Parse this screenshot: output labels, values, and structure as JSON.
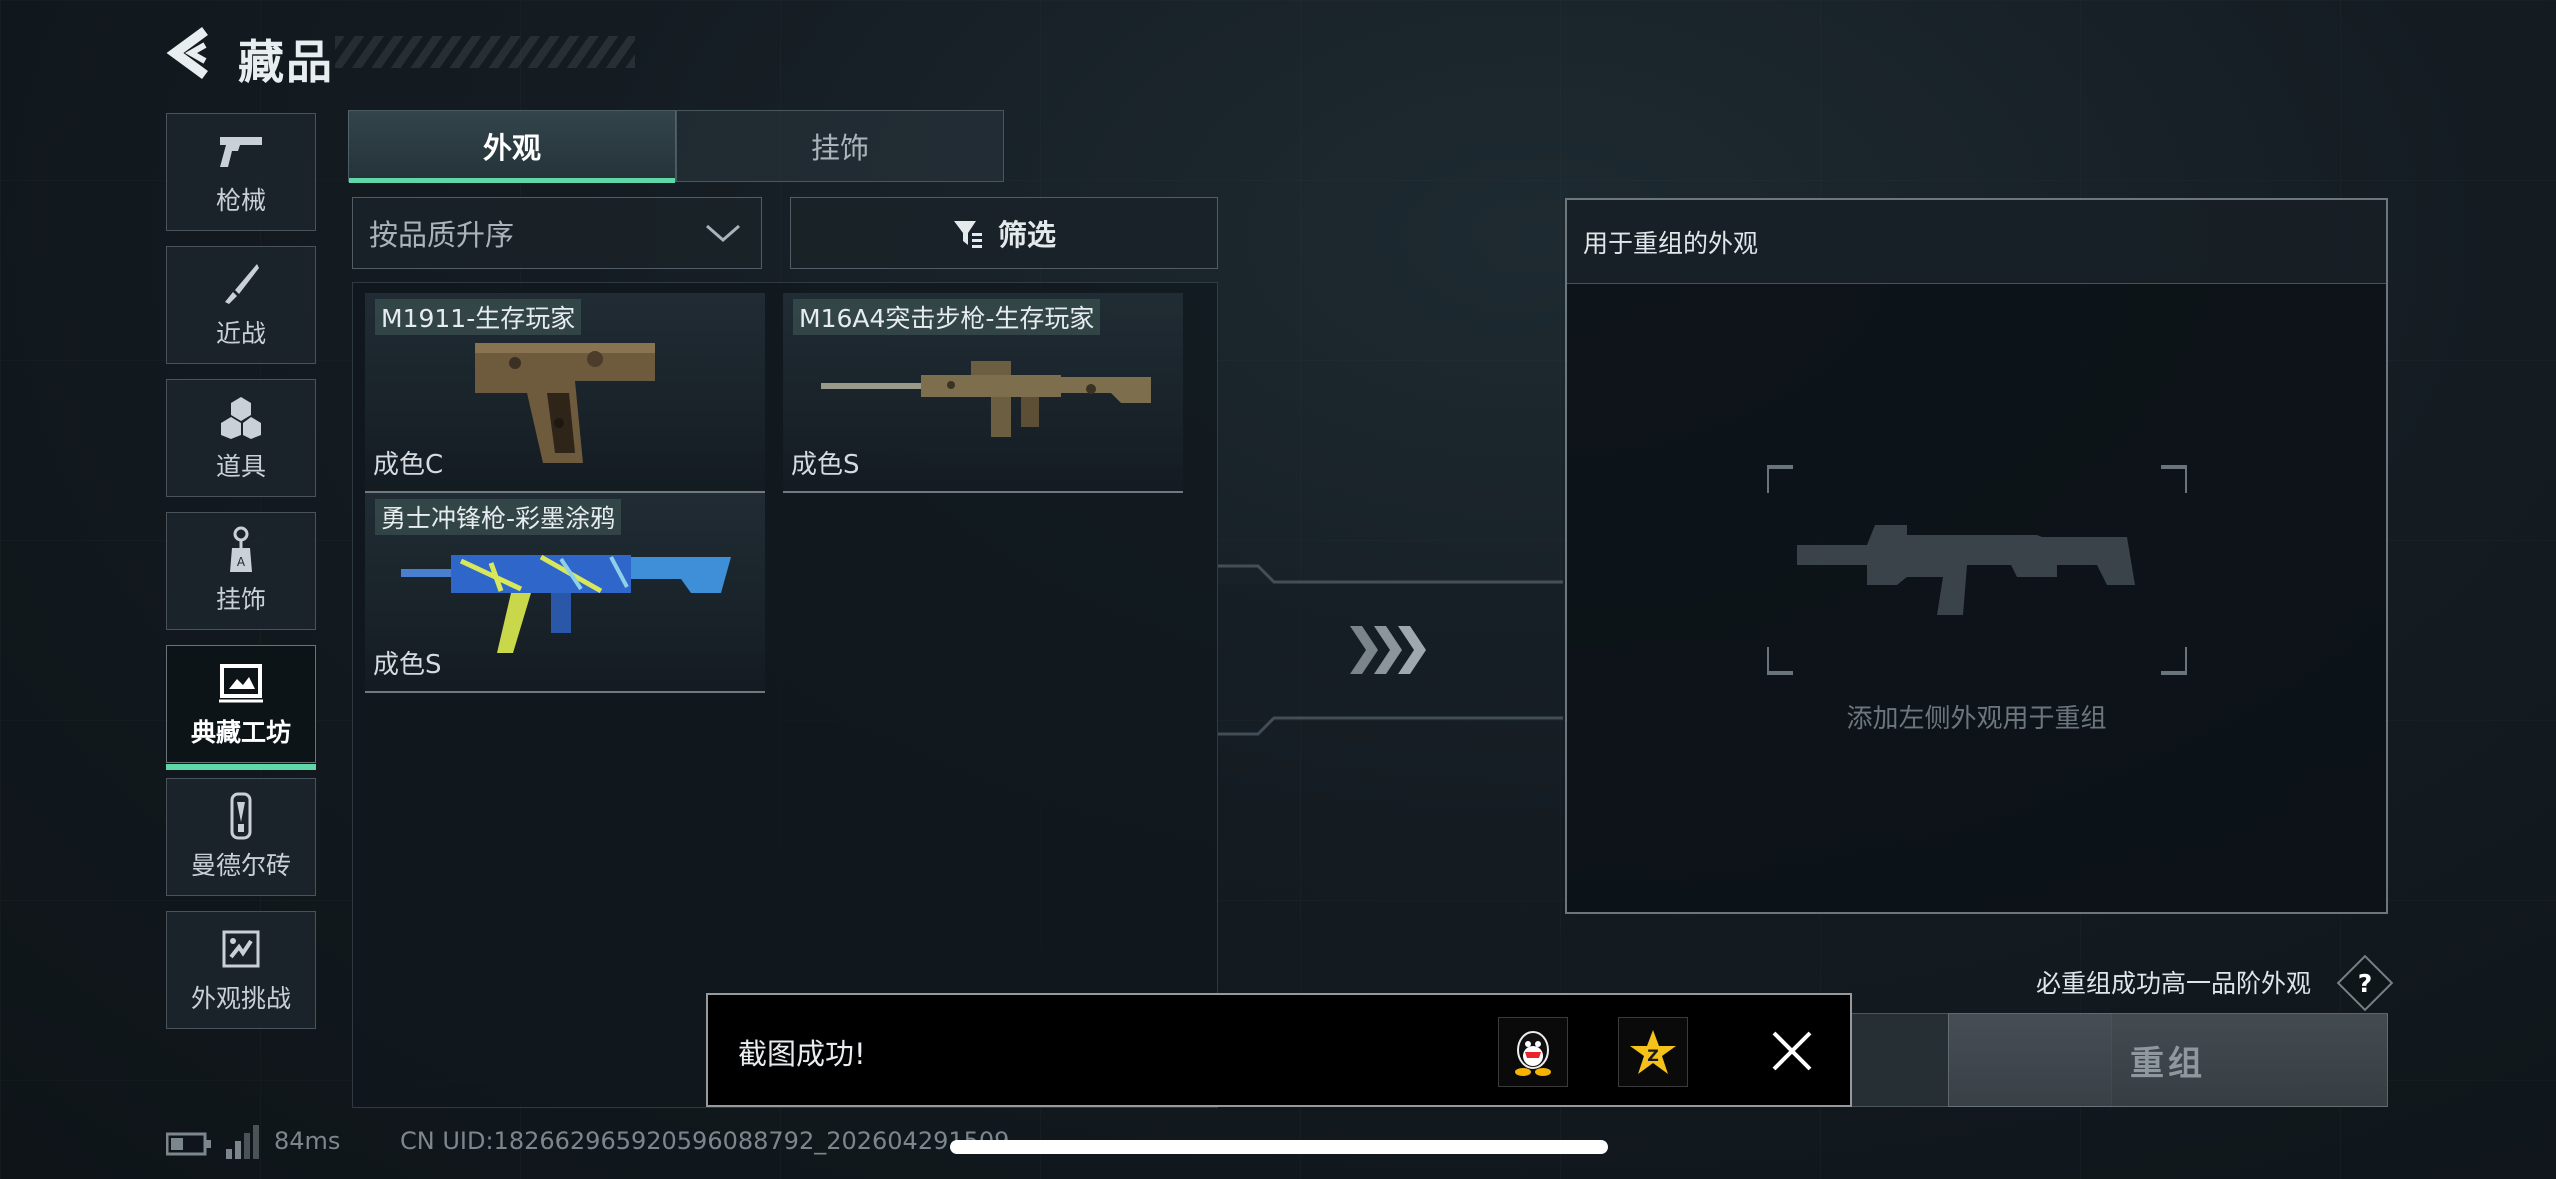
{
  "header": {
    "title": "藏品"
  },
  "sidebar": {
    "items": [
      {
        "label": "枪械",
        "icon": "gun-icon"
      },
      {
        "label": "近战",
        "icon": "knife-icon"
      },
      {
        "label": "道具",
        "icon": "grenade-icon"
      },
      {
        "label": "挂饰",
        "icon": "charm-icon"
      },
      {
        "label": "典藏工坊",
        "icon": "workshop-icon",
        "active": true
      },
      {
        "label": "曼德尔砖",
        "icon": "mandel-brick-icon"
      },
      {
        "label": "外观挑战",
        "icon": "challenge-icon"
      }
    ]
  },
  "tabs": [
    {
      "label": "外观",
      "active": true
    },
    {
      "label": "挂饰",
      "active": false
    }
  ],
  "sort": {
    "selected": "按品质升序"
  },
  "filter": {
    "label": "筛选"
  },
  "skins": [
    {
      "name": "M1911-生存玩家",
      "grade": "成色C"
    },
    {
      "name": "M16A4突击步枪-生存玩家",
      "grade": "成色S"
    },
    {
      "name": "勇士冲锋枪-彩墨涂鸦",
      "grade": "成色S"
    }
  ],
  "remodel": {
    "header": "用于重组的外观",
    "placeholder": "添加左侧外观用于重组",
    "guarantee": "必重组成功高一品阶外观",
    "help": "?",
    "button": "重组"
  },
  "status": {
    "latency": "84ms",
    "uid": "CN UID:182662965920596088792_202604291509"
  },
  "toast": {
    "message": "截图成功!"
  },
  "colors": {
    "accent": "#5fd7a6",
    "panel_border": "#bec8cd",
    "toast_bg": "#000000"
  }
}
